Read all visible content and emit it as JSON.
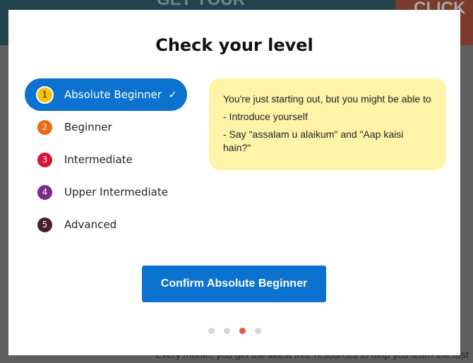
{
  "background": {
    "banner_text": "GET YOUR",
    "cta_text": "CLICK",
    "footer_text": "Every month, you get the latest free resources to help you learn the fast"
  },
  "modal": {
    "title": "Check your level",
    "levels": [
      {
        "num": "1",
        "label": "Absolute Beginner",
        "color": "#f5c400",
        "selected": true
      },
      {
        "num": "2",
        "label": "Beginner",
        "color": "#ee6a12"
      },
      {
        "num": "3",
        "label": "Intermediate",
        "color": "#d4143a"
      },
      {
        "num": "4",
        "label": "Upper Intermediate",
        "color": "#7b2a8a"
      },
      {
        "num": "5",
        "label": "Advanced",
        "color": "#4a1f2a"
      }
    ],
    "info": {
      "intro": "You're just starting out, but you might be able to",
      "points": [
        "- Introduce yourself",
        "- Say \"assalam u alaikum\" and \"Aap kaisi hain?\""
      ]
    },
    "confirm_label": "Confirm Absolute Beginner",
    "pagination": {
      "total": 4,
      "current": 3
    },
    "accent": "#0b72d0"
  }
}
